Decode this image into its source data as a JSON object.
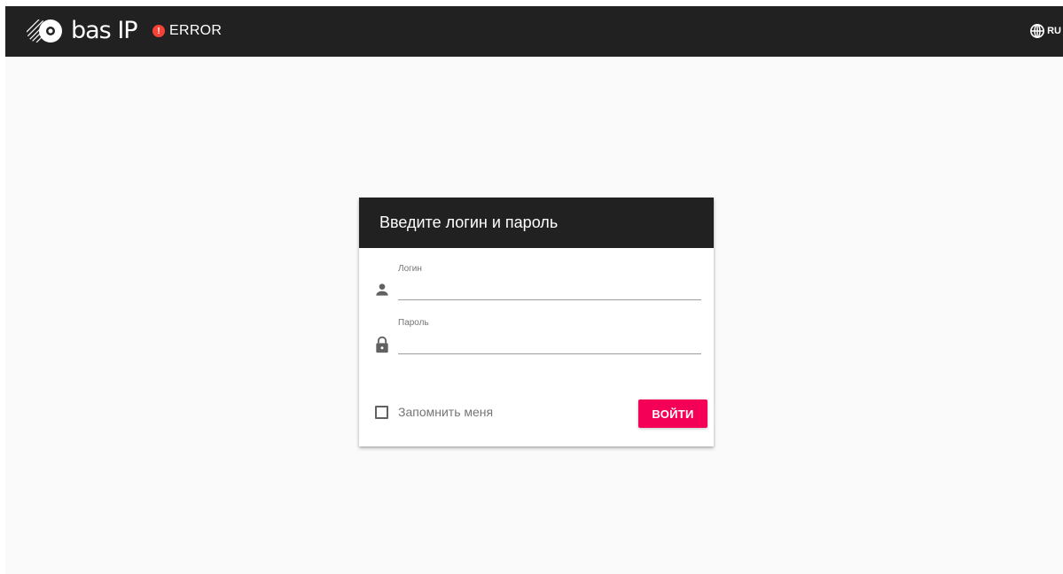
{
  "header": {
    "logo_text": "bas IP",
    "status_icon": "alert-circle-icon",
    "status_text": "ERROR",
    "language": "RU",
    "language_icon": "globe-icon"
  },
  "login_form": {
    "title": "Введите логин и пароль",
    "login": {
      "label": "Логин",
      "value": "",
      "icon": "person-icon"
    },
    "password": {
      "label": "Пароль",
      "value": "",
      "icon": "lock-icon"
    },
    "remember_label": "Запомнить меня",
    "remember_checked": false,
    "submit_label": "ВОЙТИ"
  },
  "colors": {
    "topbar": "#212121",
    "background": "#fafafa",
    "accent": "#f50057",
    "error": "#f44336"
  }
}
